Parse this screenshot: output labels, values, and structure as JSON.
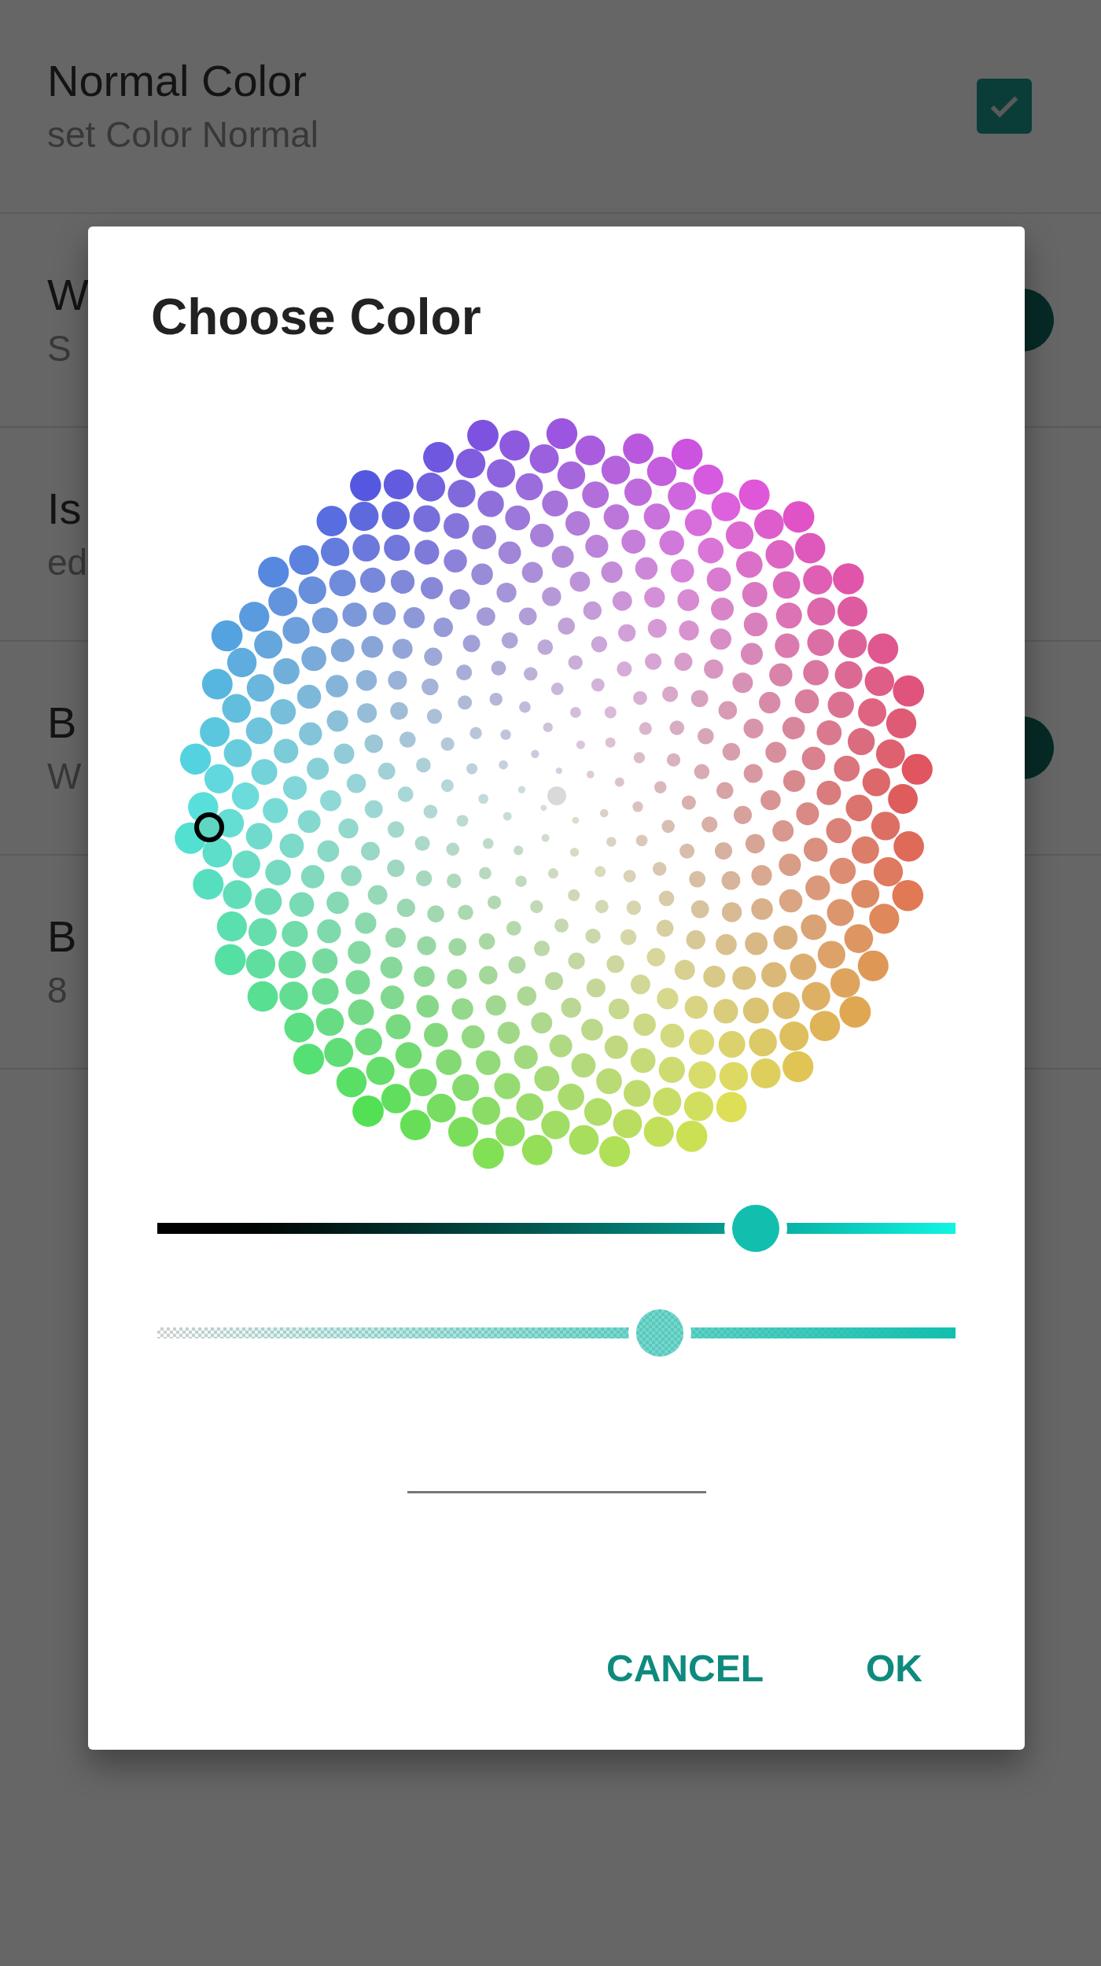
{
  "settings": [
    {
      "title": "Normal Color",
      "subtitle": "set Color Normal",
      "kind": "checkbox",
      "checked": true
    },
    {
      "title": "W",
      "subtitle": "S",
      "kind": "switch",
      "on": true
    },
    {
      "title": "Is",
      "subtitle": "ed"
    },
    {
      "title": "B",
      "subtitle": "W",
      "kind": "switch",
      "on": true
    },
    {
      "title": "B",
      "subtitle": "8"
    }
  ],
  "dialog": {
    "title": "Choose Color",
    "sliders": [
      {
        "kind": "brightness",
        "level": 0.75
      },
      {
        "kind": "alpha",
        "level": 0.63
      }
    ],
    "buttons": [
      "CANCEL",
      "OK"
    ]
  }
}
